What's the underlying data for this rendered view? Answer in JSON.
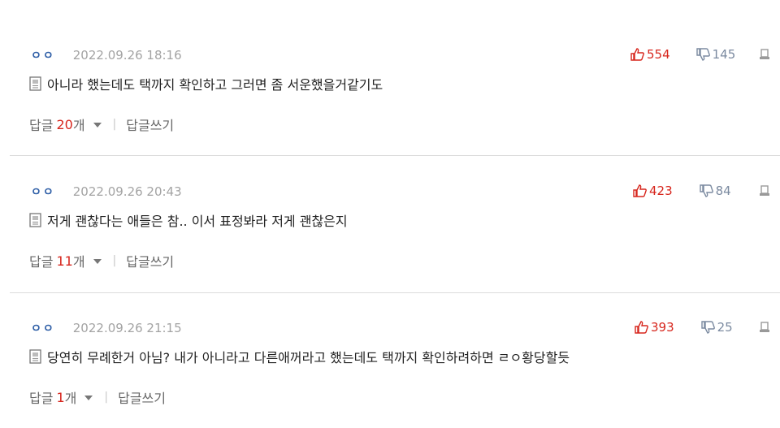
{
  "comments": [
    {
      "nickname": "ㅇㅇ",
      "date": "2022.09.26 18:16",
      "text": "아니라 했는데도 택까지 확인하고 그러면 좀 서운했을거같기도",
      "likes": "554",
      "dislikes": "145",
      "reply_label": "답글",
      "reply_count": "20",
      "reply_unit": "개",
      "separator": "|",
      "write_reply": "답글쓰기"
    },
    {
      "nickname": "ㅇㅇ",
      "date": "2022.09.26 20:43",
      "text": "저게 괜찮다는 애들은 참.. 이서 표정봐라 저게 괜찮은지",
      "likes": "423",
      "dislikes": "84",
      "reply_label": "답글",
      "reply_count": "11",
      "reply_unit": "개",
      "separator": "|",
      "write_reply": "답글쓰기"
    },
    {
      "nickname": "ㅇㅇ",
      "date": "2022.09.26 21:15",
      "text": "당연히 무례한거 아님? 내가 아니라고 다른애꺼라고 했는데도 택까지 확인하려하면 ㄹㅇ황당할듯",
      "likes": "393",
      "dislikes": "25",
      "reply_label": "답글",
      "reply_count": "1",
      "reply_unit": "개",
      "separator": "|",
      "write_reply": "답글쓰기"
    }
  ],
  "colors": {
    "like": "#d7261d",
    "dislike": "#7b8aa0",
    "nickname": "#2f5fa7",
    "date": "#a3a3a3",
    "divider": "#dcdcdc"
  },
  "icons": {
    "doc": "document-icon",
    "like": "thumbs-up-icon",
    "dislike": "thumbs-down-icon",
    "report": "report-icon",
    "caret": "caret-down-icon"
  }
}
